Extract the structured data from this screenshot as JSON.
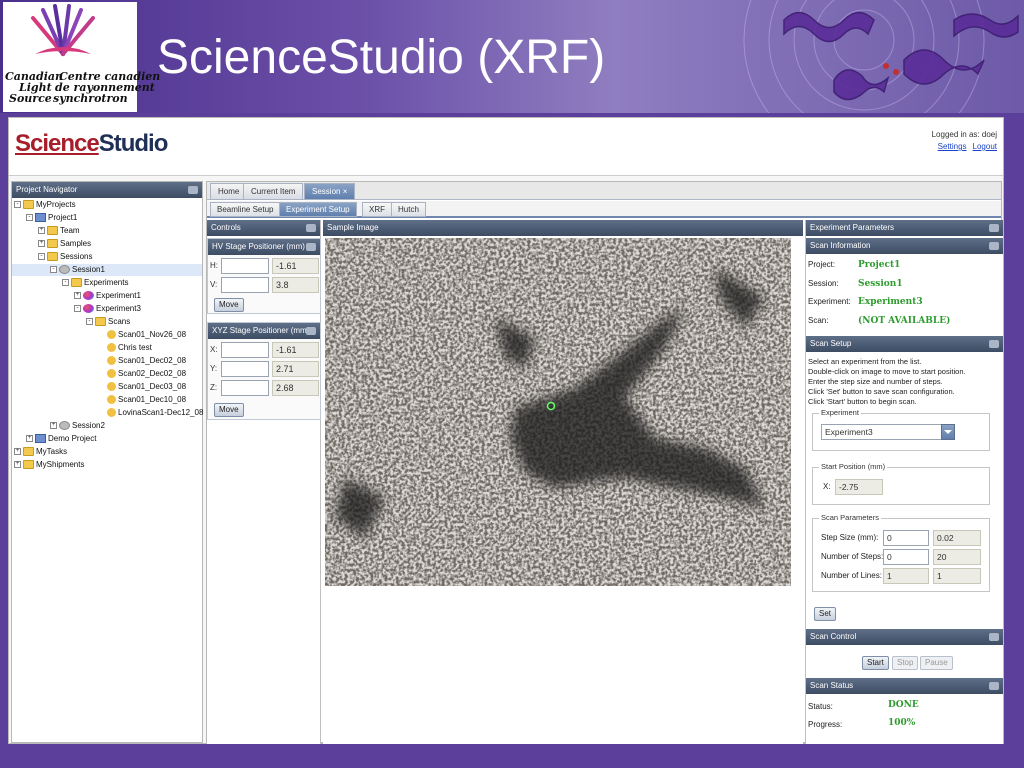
{
  "slide": {
    "title": "ScienceStudio (XRF)",
    "logo_en": [
      "Canadian",
      "Light",
      "Source"
    ],
    "logo_fr": [
      "Centre canadien",
      "de rayonnement",
      "synchrotron"
    ]
  },
  "app": {
    "brand_part1": "Science",
    "brand_part2": "Studio",
    "logged_in": "Logged in as: doej",
    "settings_link": "Settings",
    "logout_link": "Logout"
  },
  "navigator": {
    "title": "Project Navigator",
    "nodes": {
      "myprojects": "MyProjects",
      "project1": "Project1",
      "team": "Team",
      "samples": "Samples",
      "sessions": "Sessions",
      "session1": "Session1",
      "experiments": "Experiments",
      "experiment1": "Experiment1",
      "experiment3": "Experiment3",
      "scans": "Scans",
      "scan_items": [
        "Scan01_Nov26_08",
        "Chris test",
        "Scan01_Dec02_08",
        "Scan02_Dec02_08",
        "Scan01_Dec03_08",
        "Scan01_Dec10_08",
        "LovinaScan1-Dec12_08"
      ],
      "session2": "Session2",
      "demo_project": "Demo Project",
      "mytasks": "MyTasks",
      "myshipments": "MyShipments"
    }
  },
  "tabs": {
    "home": "Home",
    "current_item": "Current Item",
    "session": "Session",
    "session_close": "×"
  },
  "subtabs": {
    "beamline_setup": "Beamline Setup",
    "experiment_setup": "Experiment Setup",
    "xrf": "XRF",
    "hutch": "Hutch"
  },
  "controls": {
    "title": "Controls",
    "hv_title": "HV Stage Positioner (mm)",
    "hv_rows": [
      {
        "label": "H:",
        "value": "-1.61"
      },
      {
        "label": "V:",
        "value": "3.8"
      }
    ],
    "xyz_title": "XYZ Stage Positioner (mm)",
    "xyz_rows": [
      {
        "label": "X:",
        "value": "-1.61"
      },
      {
        "label": "Y:",
        "value": "2.71"
      },
      {
        "label": "Z:",
        "value": "2.68"
      }
    ],
    "move_label": "Move"
  },
  "sample": {
    "title": "Sample Image"
  },
  "experiment_params": {
    "title": "Experiment Parameters",
    "scan_info_title": "Scan Information",
    "info": [
      {
        "label": "Project:",
        "value": "Project1"
      },
      {
        "label": "Session:",
        "value": "Session1"
      },
      {
        "label": "Experiment:",
        "value": "Experiment3"
      },
      {
        "label": "Scan:",
        "value": "(NOT AVAILABLE)"
      }
    ],
    "scan_setup_title": "Scan Setup",
    "instructions": [
      "Select an experiment from the list.",
      "Double-click on image to move to start position.",
      "Enter the step size and number of steps.",
      "Click 'Set' button to save scan configuration.",
      "Click 'Start' button to begin scan."
    ],
    "experiment_legend": "Experiment",
    "experiment_selected": "Experiment3",
    "start_position_legend": "Start Position (mm)",
    "start_x_label": "X:",
    "start_x_value": "-2.75",
    "scan_params_legend": "Scan Parameters",
    "step_size_label": "Step Size (mm):",
    "step_size_input": "0",
    "step_size_value": "0.02",
    "num_steps_label": "Number of Steps:",
    "num_steps_input": "0",
    "num_steps_value": "20",
    "num_lines_label": "Number of Lines:",
    "num_lines_input": "1",
    "num_lines_value": "1",
    "set_label": "Set",
    "scan_control_title": "Scan Control",
    "start_label": "Start",
    "stop_label": "Stop",
    "pause_label": "Pause",
    "scan_status_title": "Scan Status",
    "status_label": "Status:",
    "status_value": "DONE",
    "progress_label": "Progress:",
    "progress_value": "100%"
  }
}
